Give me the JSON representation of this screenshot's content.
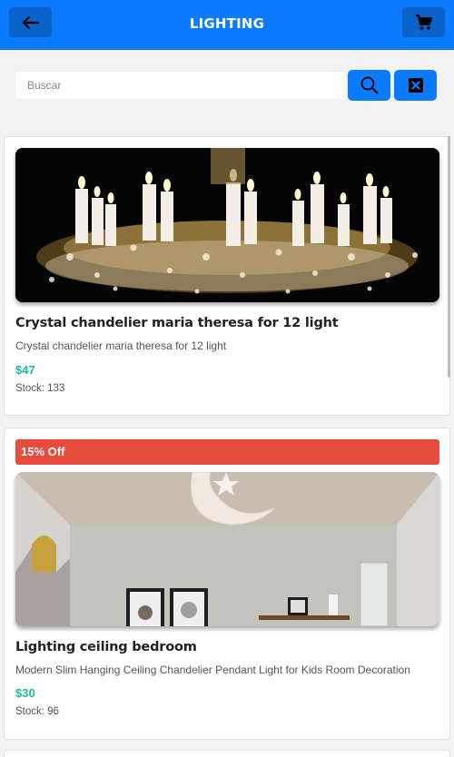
{
  "header": {
    "title": "LIGHTING",
    "back_icon": "arrow-left-icon",
    "cart_icon": "shopping-cart-icon",
    "bg_color": "#0a7bff"
  },
  "search": {
    "placeholder": "Buscar",
    "value": "",
    "search_icon": "search-icon",
    "clear_icon": "close-box-icon"
  },
  "products": [
    {
      "name": "Crystal chandelier maria theresa for 12 light",
      "description": "Crystal chandelier maria theresa for 12 light",
      "price": "$47",
      "stock": "Stock: 133",
      "discount": ""
    },
    {
      "name": "Lighting ceiling bedroom",
      "description": "Modern Slim Hanging Ceiling Chandelier Pendant Light for Kids Room Decoration",
      "price": "$30",
      "stock": "Stock: 96",
      "discount": "15% Off"
    }
  ],
  "colors": {
    "accent": "#0a7bff",
    "price": "#1abc9c",
    "discount_badge": "#e74c3c"
  }
}
